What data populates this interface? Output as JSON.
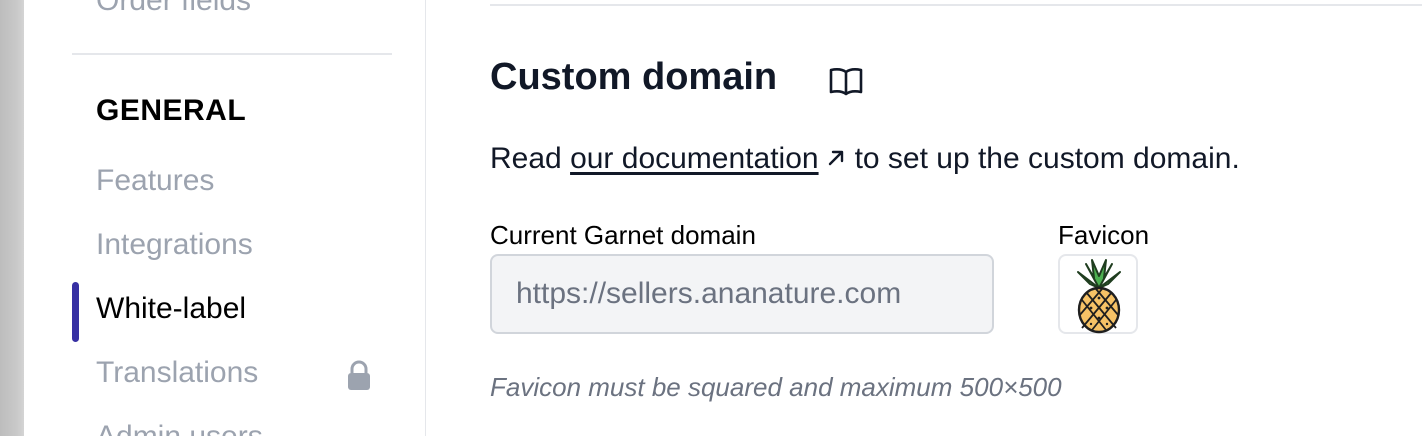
{
  "sidebar": {
    "cut_item_label": "Order fields",
    "section_title": "GENERAL",
    "items": [
      {
        "label": "Features",
        "active": false
      },
      {
        "label": "Integrations",
        "active": false
      },
      {
        "label": "White-label",
        "active": true
      },
      {
        "label": "Translations",
        "active": false,
        "locked": true
      },
      {
        "label": "Admin users",
        "active": false
      }
    ],
    "lock_icon": "lock-icon"
  },
  "main": {
    "title": "Custom domain",
    "title_icon": "book-icon",
    "doc_prefix": "Read ",
    "doc_link": "our documentation",
    "doc_suffix": "to set up the custom domain.",
    "domain_label": "Current Garnet domain",
    "domain_value": "https://sellers.ananature.com",
    "favicon_label": "Favicon",
    "favicon_icon": "pineapple-icon",
    "favicon_hint": "Favicon must be squared and maximum 500×500"
  },
  "colors": {
    "accent": "#3730a3",
    "muted": "#9ca3af",
    "input_bg": "#f3f4f6"
  }
}
